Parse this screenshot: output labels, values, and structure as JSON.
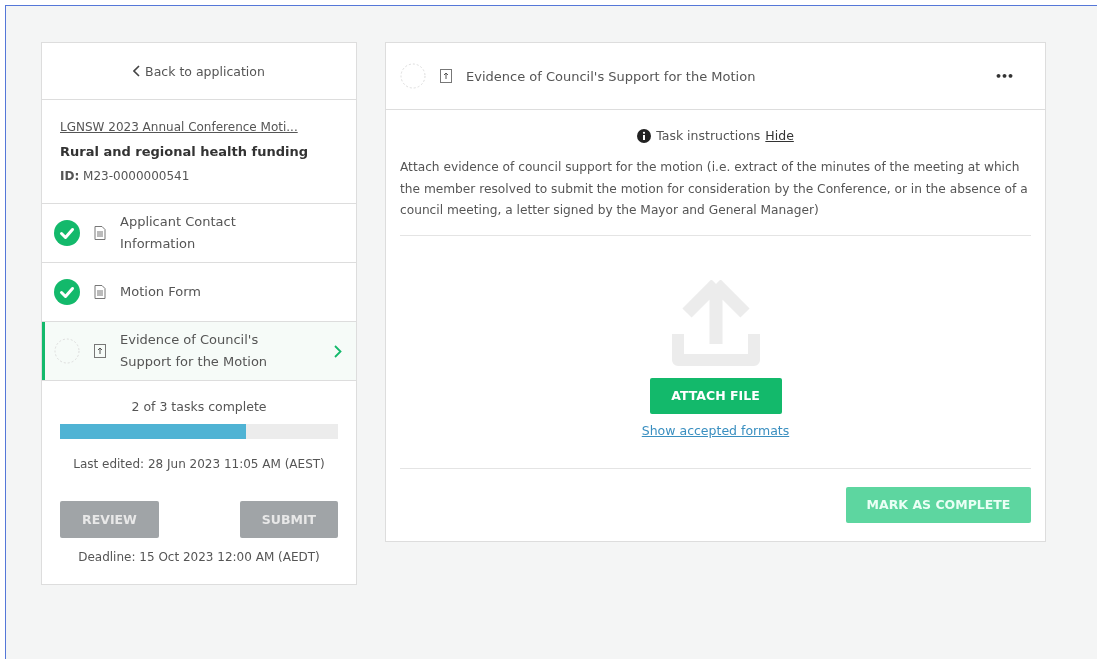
{
  "sidebar": {
    "back_link": "Back to application",
    "application_link": "LGNSW 2023 Annual Conference Moti...",
    "application_title": "Rural and regional health funding",
    "id_label": "ID:",
    "id_value": "M23-0000000541",
    "tasks": [
      {
        "label": "Applicant Contact Information",
        "kind": "form",
        "complete": true,
        "selected": false
      },
      {
        "label": "Motion Form",
        "kind": "form",
        "complete": true,
        "selected": false
      },
      {
        "label": "Evidence of Council's Support for the Motion",
        "kind": "upload",
        "complete": false,
        "selected": true
      }
    ],
    "progress_text": "2 of 3 tasks complete",
    "progress": {
      "level": 0.67
    },
    "last_edited": "Last edited: 28 Jun 2023 11:05 AM (AEST)",
    "buttons": [
      {
        "label": "REVIEW",
        "disabled": true
      },
      {
        "label": "SUBMIT",
        "disabled": true
      }
    ],
    "deadline": "Deadline: 15 Oct 2023 12:00 AM (AEDT)"
  },
  "task_panel": {
    "title": "Evidence of Council's Support for the Motion",
    "kind": "upload",
    "complete": false,
    "more_menu": "•••",
    "instructions_label": "Task instructions",
    "instructions_toggle": "Hide",
    "instructions": "Attach evidence of council support for the motion (i.e. extract of the minutes of the meeting at which the member resolved to submit the motion for consideration by the Conference, or in the absence of a council meeting, a letter signed by the Mayor and General Manager)",
    "attach_button": "ATTACH FILE",
    "formats_link": "Show accepted formats",
    "complete_button": {
      "label": "MARK AS COMPLETE",
      "disabled": true
    }
  }
}
